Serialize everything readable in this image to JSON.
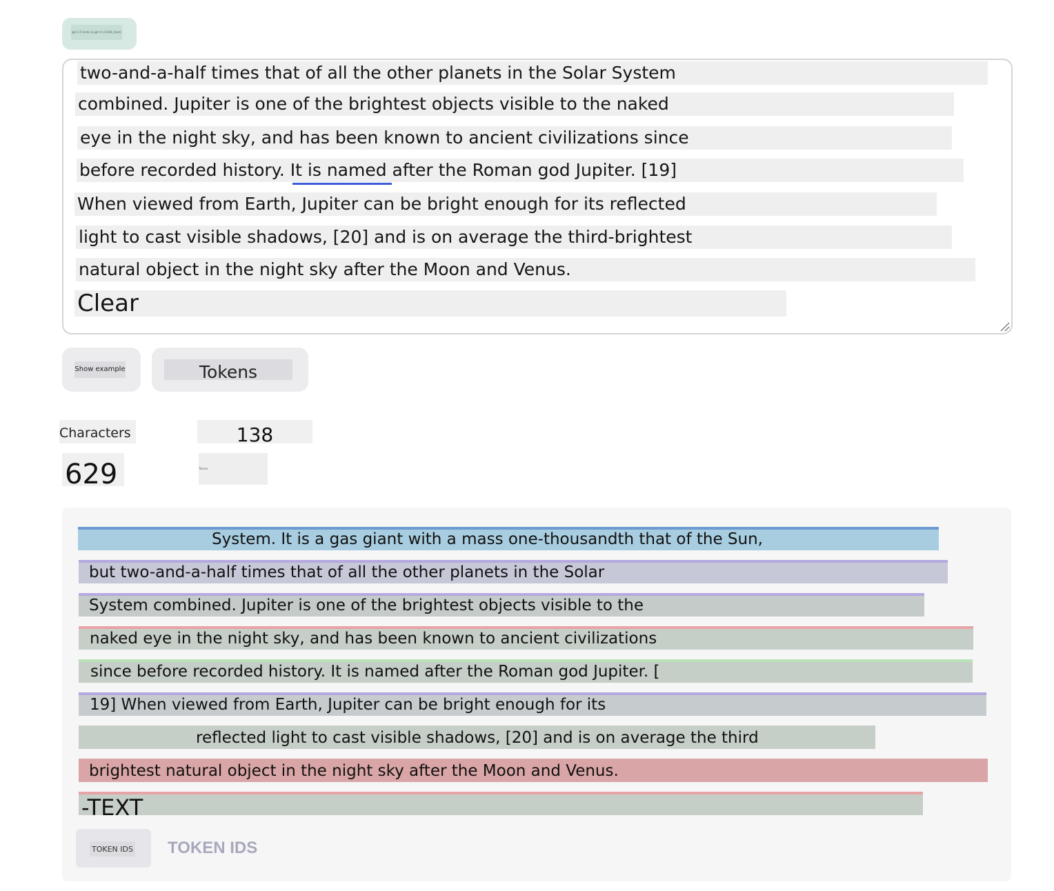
{
  "top_pill": {
    "label": "gpt-3.5-turbo & gpt-4 (cl100k_base)"
  },
  "editor": {
    "lines": [
      "two-and-a-half times that of all the other planets in the Solar System",
      "combined. Jupiter is one of the brightest objects visible to the naked",
      "eye in the night sky, and has been known to ancient civilizations since",
      "before recorded history. It is named after the Roman god Jupiter. [19]",
      "When viewed from Earth, Jupiter can be bright enough for its reflected",
      "light to cast visible shadows, [20] and is on average the third-brightest",
      "natural object in the night sky after the Moon and Venus."
    ],
    "clear_label": "Clear"
  },
  "buttons": {
    "show_example": "Show example",
    "tokens": "Tokens"
  },
  "stats": {
    "characters_label": "Characters",
    "tokens_value": "138",
    "characters_value": "629",
    "tokens_label": "Tokens"
  },
  "token_view": {
    "lines": [
      "System. It is a gas giant with a mass one-thousandth that of the Sun,",
      "but two-and-a-half times that of all the other planets in the Solar",
      "System combined. Jupiter is one of the brightest objects visible to the",
      "naked eye in the night sky, and has been known to ancient civilizations",
      "since before recorded history. It is named after the Roman god Jupiter. [",
      "19] When viewed from Earth, Jupiter can be bright enough for its",
      "reflected light to cast visible shadows, [20] and is on average the third",
      "brightest natural object in the night sky after the Moon and Venus.",
      "-TEXT"
    ],
    "colors": [
      "#a8cde0",
      "#c6c8d8",
      "#c4cbc9",
      "#c6cec8",
      "#c6cec8",
      "#c6ccce",
      "#c6cec8",
      "#d9a5a6",
      "#c6cec8"
    ],
    "accent_colors": [
      "#6b9bd1",
      "#b5a8e0",
      "#b5a8e0",
      "#e8a3a6",
      "#b9e3b7",
      "#b5a8e0",
      "#c6cec8",
      "#d9a5a6",
      "#e8a3a6"
    ],
    "ids_button": "TOKEN IDS",
    "ids_label": "TOKEN IDS"
  }
}
